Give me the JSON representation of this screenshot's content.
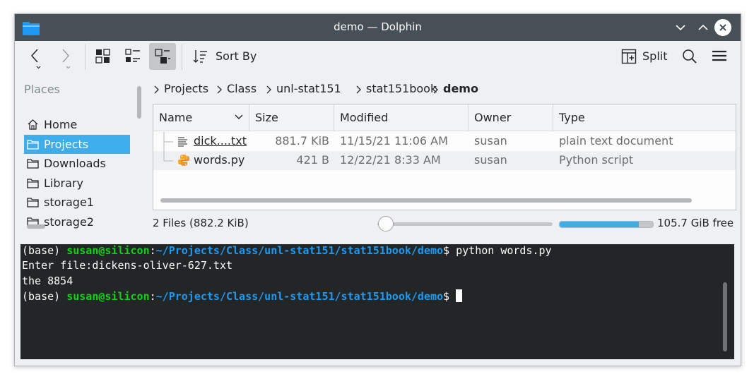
{
  "window": {
    "title": "demo — Dolphin"
  },
  "toolbar": {
    "sort_label": "Sort By",
    "split_label": "Split"
  },
  "places": {
    "title": "Places",
    "items": [
      {
        "label": "Home",
        "icon": "home-icon"
      },
      {
        "label": "Projects",
        "icon": "folder-icon",
        "selected": true
      },
      {
        "label": "Downloads",
        "icon": "folder-icon"
      },
      {
        "label": "Library",
        "icon": "folder-icon"
      },
      {
        "label": "storage1",
        "icon": "folder-icon"
      },
      {
        "label": "storage2",
        "icon": "folder-icon"
      }
    ]
  },
  "breadcrumb": [
    "Projects",
    "Class",
    "unl-stat151",
    "stat151book",
    "demo"
  ],
  "columns": [
    "Name",
    "Size",
    "Modified",
    "Owner",
    "Type"
  ],
  "files": [
    {
      "name": "dick....txt",
      "size": "881.7 KiB",
      "modified": "11/15/21 11:06 AM",
      "owner": "susan",
      "type": "plain text document",
      "icon": "text-file-icon"
    },
    {
      "name": "words.py",
      "size": "421 B",
      "modified": "12/22/21 8:33 AM",
      "owner": "susan",
      "type": "Python script",
      "icon": "python-file-icon"
    }
  ],
  "status": {
    "summary": "2 Files (882.2 KiB)",
    "free_space": "105.7 GiB free",
    "used_fraction": 0.85
  },
  "terminal": {
    "prompt_env": "(base) ",
    "prompt_user": "susan@silicon",
    "prompt_sep": ":",
    "prompt_path": "~/Projects/Class/unl-stat151/stat151book/demo",
    "prompt_symbol": "$ ",
    "command": "python words.py",
    "output_line1": "Enter file:dickens-oliver-627.txt",
    "output_line2": "the 8854"
  },
  "colors": {
    "accent": "#3daee9",
    "titlebar": "#475057",
    "terminal_bg": "#232627",
    "prompt_user": "#11d116",
    "prompt_path": "#1d99f3"
  }
}
